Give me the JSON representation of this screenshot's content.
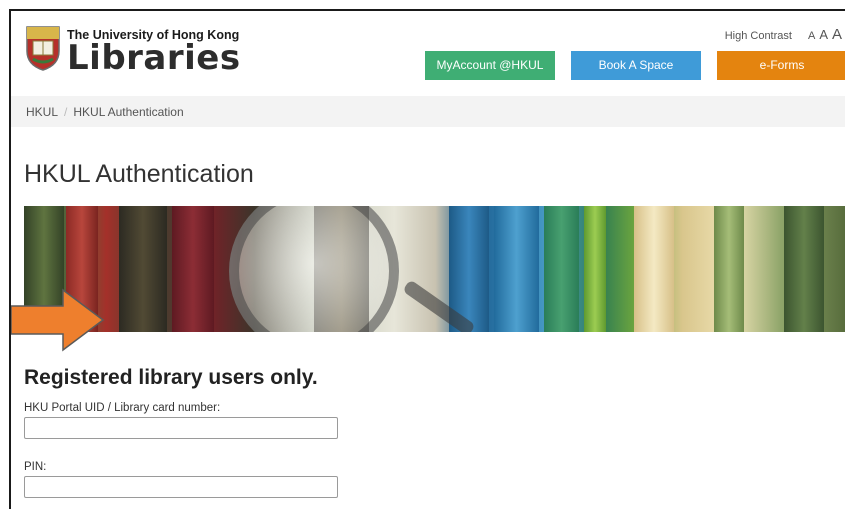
{
  "header": {
    "university_name": "The University of Hong Kong",
    "libraries_name": "Libraries",
    "high_contrast": "High Contrast",
    "font_size_options": [
      "A",
      "A",
      "A"
    ]
  },
  "nav_buttons": [
    {
      "label": "MyAccount @HKUL",
      "color": "#3fae74"
    },
    {
      "label": "Book A Space",
      "color": "#3f9bd8"
    },
    {
      "label": "e-Forms",
      "color": "#e4840f"
    }
  ],
  "breadcrumb": {
    "items": [
      "HKUL",
      "HKUL Authentication"
    ],
    "separator": "/"
  },
  "page": {
    "title": "HKUL Authentication",
    "banner_icon": "magnifying-glass-over-books",
    "pointer_icon": "orange-arrow-right"
  },
  "login_form": {
    "heading": "Registered library users only.",
    "uid_label": "HKU Portal UID / Library card number:",
    "uid_value": "",
    "pin_label": "PIN:",
    "pin_value": ""
  }
}
